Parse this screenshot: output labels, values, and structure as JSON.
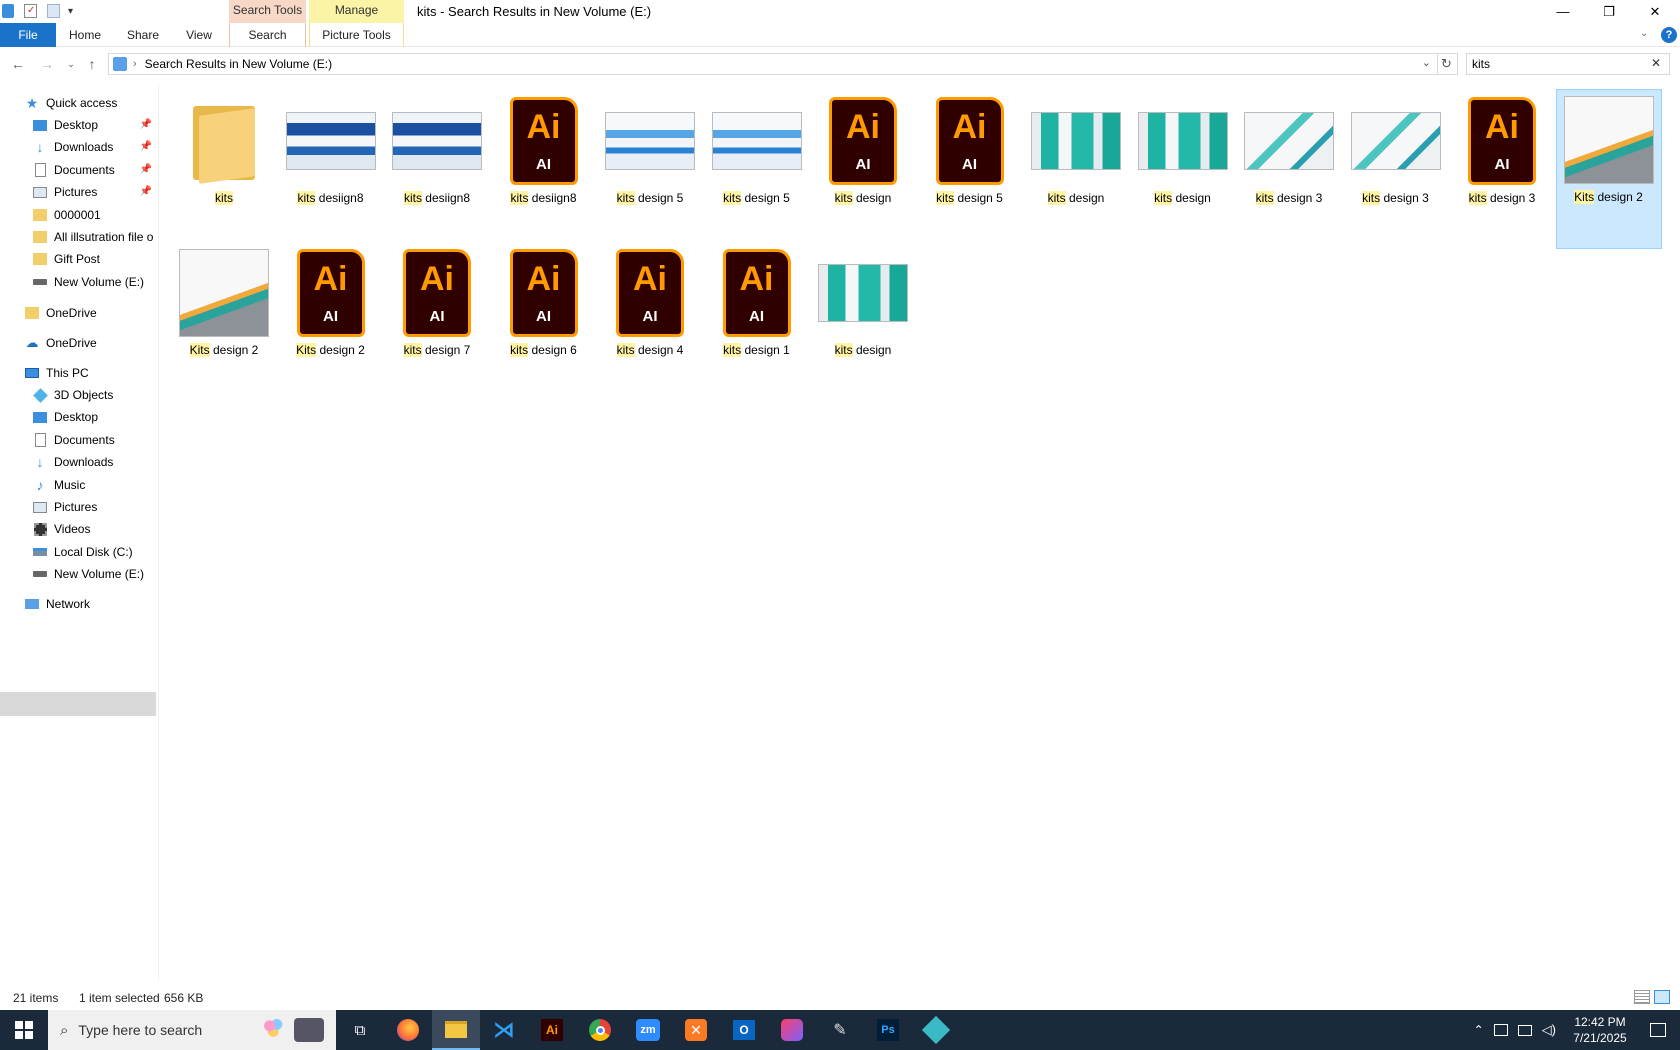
{
  "window": {
    "title": "kits - Search Results in New Volume (E:)",
    "minimize": "—",
    "restore": "❐",
    "close": "✕"
  },
  "ribbon": {
    "context_tabs": {
      "search_tools": "Search Tools",
      "manage": "Manage"
    },
    "tabs": {
      "file": "File",
      "home": "Home",
      "share": "Share",
      "view": "View",
      "search": "Search",
      "picture_tools": "Picture Tools"
    }
  },
  "address": {
    "path": "Search Results in New Volume (E:)",
    "search_value": "kits"
  },
  "nav": {
    "quick_access": "Quick access",
    "quick_items": [
      {
        "label": "Desktop",
        "pinned": true
      },
      {
        "label": "Downloads",
        "pinned": true
      },
      {
        "label": "Documents",
        "pinned": true
      },
      {
        "label": "Pictures",
        "pinned": true
      },
      {
        "label": "0000001",
        "pinned": false
      },
      {
        "label": "All illsutration file o",
        "pinned": false
      },
      {
        "label": "Gift Post",
        "pinned": false
      },
      {
        "label": "New Volume (E:)",
        "pinned": false
      }
    ],
    "onedrive_1": "OneDrive",
    "onedrive_2": "OneDrive",
    "this_pc": "This PC",
    "pc_items": [
      "3D Objects",
      "Desktop",
      "Documents",
      "Downloads",
      "Music",
      "Pictures",
      "Videos",
      "Local Disk (C:)",
      "New Volume (E:)"
    ],
    "network": "Network"
  },
  "files": [
    {
      "match": "kits",
      "rest": "",
      "kind": "folder"
    },
    {
      "match": "kits",
      "rest": " desiign8",
      "kind": "photo-blue"
    },
    {
      "match": "kits",
      "rest": " desiign8",
      "kind": "photo-blue"
    },
    {
      "match": "kits",
      "rest": " desiign8",
      "kind": "ai"
    },
    {
      "match": "kits",
      "rest": " design 5",
      "kind": "photo-lightblue"
    },
    {
      "match": "kits",
      "rest": " design 5",
      "kind": "photo-lightblue"
    },
    {
      "match": "kits",
      "rest": " design",
      "kind": "ai"
    },
    {
      "match": "kits",
      "rest": " design 5",
      "kind": "ai"
    },
    {
      "match": "kits",
      "rest": " design",
      "kind": "photo-teal"
    },
    {
      "match": "kits",
      "rest": " design",
      "kind": "photo-teal"
    },
    {
      "match": "kits",
      "rest": " design 3",
      "kind": "photo-tealwhite"
    },
    {
      "match": "kits",
      "rest": " design 3",
      "kind": "photo-tealwhite"
    },
    {
      "match": "kits",
      "rest": " design 3",
      "kind": "ai"
    },
    {
      "match": "Kits",
      "rest": " design 2",
      "kind": "photo-letter",
      "selected": true
    },
    {
      "match": "Kits",
      "rest": " design 2",
      "kind": "photo-letter"
    },
    {
      "match": "Kits",
      "rest": " design 2",
      "kind": "ai"
    },
    {
      "match": "kits",
      "rest": " design 7",
      "kind": "ai"
    },
    {
      "match": "kits",
      "rest": " design 6",
      "kind": "ai"
    },
    {
      "match": "kits",
      "rest": " design 4",
      "kind": "ai"
    },
    {
      "match": "kits",
      "rest": " design 1",
      "kind": "ai"
    },
    {
      "match": "kits",
      "rest": " design",
      "kind": "photo-teal"
    }
  ],
  "ai_icon": {
    "big": "Ai",
    "small": "AI"
  },
  "status": {
    "count": "21 items",
    "selection": "1 item selected",
    "size": "656 KB"
  },
  "taskbar": {
    "search_placeholder": "Type here to search",
    "time": "12:42 PM",
    "date": "7/21/2025"
  },
  "colors": {
    "accent": "#1a73c8",
    "highlight": "#fff3a4",
    "selection": "#cce8ff",
    "ai_bg": "#300000",
    "ai_fg": "#ff9a00",
    "taskbar": "#1b2a3b"
  }
}
